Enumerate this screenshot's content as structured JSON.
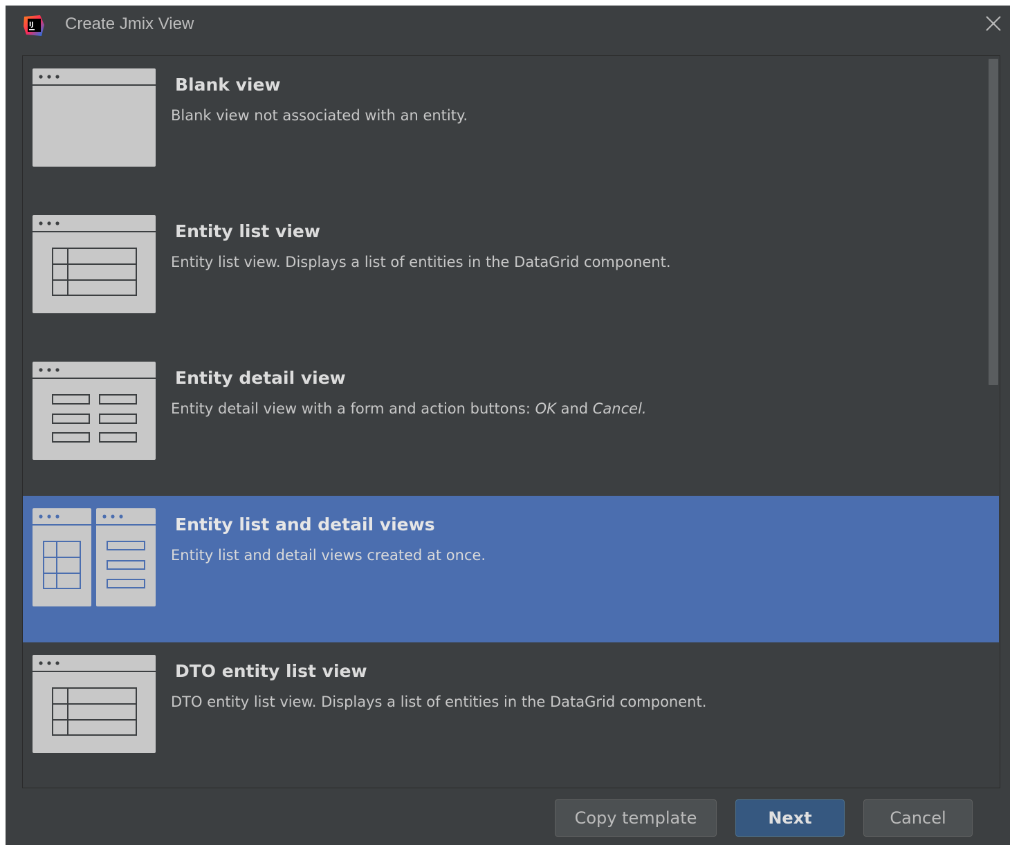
{
  "window": {
    "title": "Create Jmix View"
  },
  "icons": {
    "app": "intellij-app-icon",
    "close": "close-icon"
  },
  "templates": [
    {
      "title": "Blank view",
      "description": "Blank view not associated with an entity.",
      "icon": "blank-view-icon",
      "selected": false
    },
    {
      "title": "Entity list view",
      "description": "Entity list view. Displays a list of entities in the DataGrid component.",
      "icon": "list-view-icon",
      "selected": false
    },
    {
      "title": "Entity detail view",
      "description_prefix": "Entity detail view with a form and action buttons: ",
      "description_ok": "OK",
      "description_and": " and ",
      "description_cancel": "Cancel.",
      "icon": "detail-view-icon",
      "selected": false
    },
    {
      "title": "Entity list and detail views",
      "description": "Entity list and detail views created at once.",
      "icon": "list-and-detail-views-icon",
      "selected": true
    },
    {
      "title": "DTO entity list view",
      "description": "DTO entity list view. Displays a list of entities in the DataGrid component.",
      "icon": "dto-list-view-icon",
      "selected": false
    }
  ],
  "buttons": {
    "copy_template": "Copy template",
    "next": "Next",
    "cancel": "Cancel"
  },
  "colors": {
    "dialog_bg": "#3c3f41",
    "selection": "#4b6eaf",
    "icon_fill": "#c8c8c8",
    "primary_button": "#365880"
  }
}
